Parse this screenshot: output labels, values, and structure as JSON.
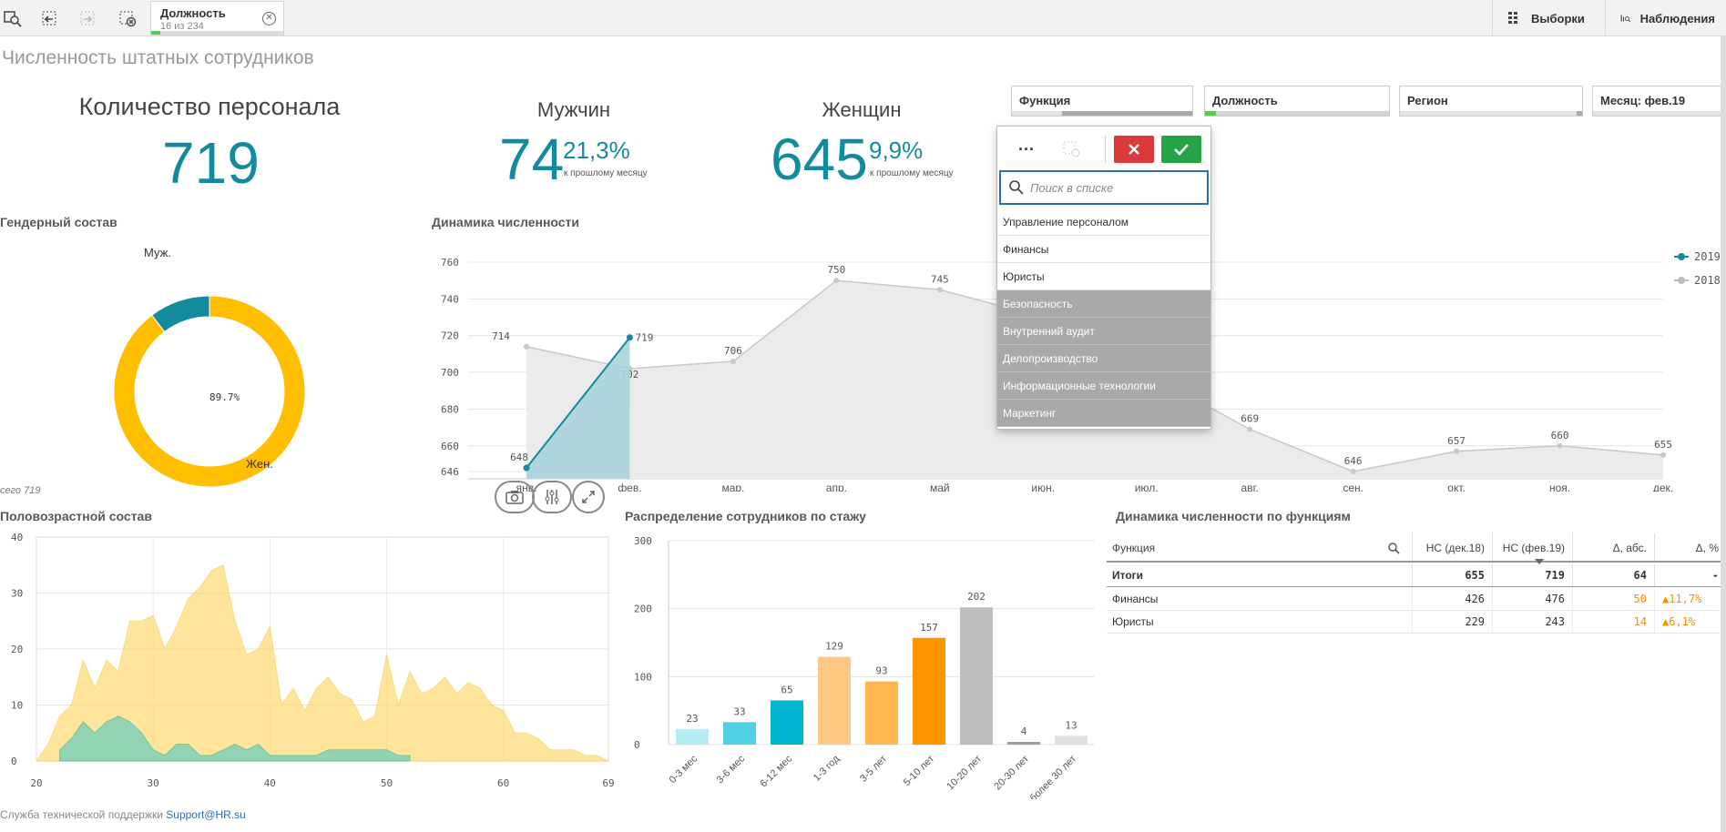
{
  "toolbar": {
    "selection": {
      "field": "Должность",
      "count": "16 из 234",
      "fraction": 0.07
    },
    "selections_label": "Выборки",
    "observations_label": "Наблюдения"
  },
  "sheet_title": "Численность штатных сотрудников",
  "kpis": {
    "total": {
      "title": "Количество персонала",
      "value": "719"
    },
    "men": {
      "title": "Мужчин",
      "value": "74",
      "pct": "21,3%",
      "note": "к прошлому месяцу"
    },
    "women": {
      "title": "Женщин",
      "value": "645",
      "pct": "9,9%",
      "note": "к прошлому месяцу"
    }
  },
  "filters": [
    {
      "label": "Функция"
    },
    {
      "label": "Должность"
    },
    {
      "label": "Регион"
    },
    {
      "label": "Месяц: фев.19"
    }
  ],
  "dropdown": {
    "search_placeholder": "Поиск в списке",
    "items": [
      {
        "label": "Управление персоналом",
        "state": "possible"
      },
      {
        "label": "Финансы",
        "state": "possible"
      },
      {
        "label": "Юристы",
        "state": "possible"
      },
      {
        "label": "Безопасность",
        "state": "excluded"
      },
      {
        "label": "Внутренний аудит",
        "state": "excluded"
      },
      {
        "label": "Делопроизводство",
        "state": "excluded"
      },
      {
        "label": "Информационные технологии",
        "state": "excluded"
      },
      {
        "label": "Маркетинг",
        "state": "excluded"
      }
    ]
  },
  "gender": {
    "title": "Гендерный состав",
    "men_label": "Муж.",
    "women_label": "Жен.",
    "pct_label": "89.7%",
    "footer": "сего 719"
  },
  "dynamics": {
    "title": "Динамика численности"
  },
  "age": {
    "title": "Половозрастной состав"
  },
  "tenure": {
    "title": "Распределение сотрудников по стажу"
  },
  "func_table": {
    "title": "Динамика численности по функциям",
    "headers": [
      "Функция",
      "НС (дек.18)",
      "НС (фев.19)",
      "Δ, абс.",
      "Δ, %"
    ],
    "totals": [
      "Итоги",
      "655",
      "719",
      "64",
      "-"
    ],
    "rows": [
      [
        "Финансы",
        "426",
        "476",
        "50",
        "▲11,7%"
      ],
      [
        "Юристы",
        "229",
        "243",
        "14",
        "▲6,1%"
      ]
    ]
  },
  "footer": {
    "text": "Служба технической поддержки ",
    "link": "Support@HR.su"
  },
  "colors": {
    "accent": "#138a9e",
    "women": "#ffbe00",
    "men": "#138a9e",
    "up": "#f29100"
  },
  "chart_data": [
    {
      "type": "pie",
      "categories": [
        "Муж.",
        "Жен."
      ],
      "values": [
        74,
        645
      ],
      "title": "Гендерный состав"
    },
    {
      "type": "area",
      "title": "Динамика численности",
      "categories": [
        "янв.",
        "фев.",
        "мар.",
        "апр.",
        "май",
        "июн.",
        "июл.",
        "авг.",
        "сен.",
        "окт.",
        "ноя.",
        "дек."
      ],
      "ylim": [
        646,
        760
      ],
      "yticks": [
        646,
        660,
        680,
        700,
        720,
        740,
        760
      ],
      "series": [
        {
          "name": "2019",
          "values": [
            648,
            719,
            null,
            null,
            null,
            null,
            null,
            null,
            null,
            null,
            null,
            null
          ]
        },
        {
          "name": "2018",
          "values": [
            714,
            702,
            706,
            750,
            745,
            730,
            700,
            669,
            646,
            657,
            660,
            655
          ]
        }
      ],
      "legend": "right"
    },
    {
      "type": "area",
      "title": "Половозрастной состав",
      "xlim": [
        20,
        69
      ],
      "ylim": [
        0,
        40
      ],
      "xticks": [
        20,
        30,
        40,
        50,
        60,
        69
      ],
      "yticks": [
        0,
        10,
        20,
        30,
        40
      ],
      "series": [
        {
          "x": [
            20,
            21,
            22,
            23,
            24,
            25,
            26,
            27,
            28,
            29,
            30,
            31,
            32,
            33,
            34,
            35,
            36,
            37,
            38,
            39,
            40,
            41,
            42,
            43,
            44,
            45,
            46,
            47,
            48,
            49,
            50,
            51,
            52,
            53,
            54,
            55,
            56,
            57,
            58,
            59,
            60,
            61,
            62,
            63,
            64,
            65,
            66,
            67,
            68,
            69
          ],
          "values": [
            0,
            3,
            8,
            10,
            18,
            13,
            18,
            16,
            25,
            25,
            26,
            20,
            24,
            29,
            31,
            34,
            35,
            25,
            19,
            20,
            24,
            10,
            13,
            9,
            13,
            15,
            12,
            11,
            7,
            8,
            19,
            10,
            16,
            12,
            13,
            15,
            12,
            14,
            13,
            10,
            9,
            5,
            5,
            4,
            2,
            2,
            2,
            1,
            1,
            0
          ]
        },
        {
          "x": [
            22,
            23,
            24,
            25,
            26,
            27,
            28,
            29,
            30,
            31,
            32,
            33,
            34,
            35,
            36,
            37,
            38,
            39,
            40,
            41,
            42,
            43,
            44,
            45,
            46,
            47,
            48,
            49,
            50,
            51,
            52
          ],
          "values": [
            2,
            4,
            7,
            5,
            7,
            8,
            7,
            5,
            2,
            1,
            3,
            3,
            1,
            1,
            2,
            3,
            2,
            3,
            1,
            1,
            1,
            1,
            1,
            2,
            2,
            2,
            2,
            2,
            2,
            1,
            1
          ]
        }
      ]
    },
    {
      "type": "bar",
      "title": "Распределение сотрудников по стажу",
      "categories": [
        "0-3 мес",
        "3-6 мес",
        "6-12 мес",
        "1-3 год",
        "3-5 лет",
        "5-10 лет",
        "10-20 лет",
        "20-30 лет",
        "более 30 лет"
      ],
      "values": [
        23,
        33,
        65,
        129,
        93,
        157,
        202,
        4,
        13
      ],
      "ylim": [
        0,
        300
      ],
      "yticks": [
        0,
        100,
        200,
        300
      ],
      "colors": [
        "#b5ebf2",
        "#4fd0e3",
        "#00b5d3",
        "#ffc984",
        "#ffb74d",
        "#ff9300",
        "#bdbdbd",
        "#9e9e9e",
        "#e0e0e0"
      ]
    }
  ]
}
